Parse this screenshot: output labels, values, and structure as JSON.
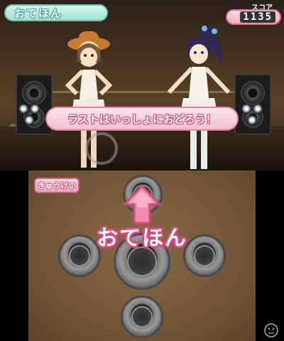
{
  "top_screen": {
    "title": "おてほん",
    "score_label": "スコア",
    "score_value": "1135",
    "dialog": "ラストはいっしょにおどろう！"
  },
  "bottom_screen": {
    "back_button": "きゅうけい",
    "move_name": "おてほん",
    "direction_indicator": "up-arrow-icon"
  },
  "colors": {
    "accent_pink": "#e87fa2",
    "title_mint": "#a4e2d4",
    "floor_brown": "#6d5234"
  }
}
